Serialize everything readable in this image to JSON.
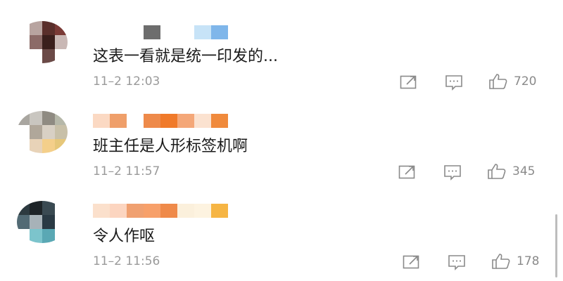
{
  "comments": [
    {
      "content": "这表一看就是统一印发的...",
      "time": "11–2 12:03",
      "likes": "720",
      "avatar_colors": [
        "#ffffff",
        "#b8a4a0",
        "#5a2f2b",
        "#7a3a36",
        "#ffffff",
        "#8c6b68",
        "#3a1f1c",
        "#c9b8b5",
        "#ffffff",
        "#ffffff",
        "#6b4a47",
        "#ffffff"
      ],
      "name_colors": [
        "#ffffff",
        "#ffffff",
        "#ffffff",
        "#6d6d6d",
        "#ffffff",
        "#ffffff",
        "#c7e3f7",
        "#7fb6ea"
      ]
    },
    {
      "content": "班主任是人形标签机啊",
      "time": "11–2 11:57",
      "likes": "345",
      "avatar_colors": [
        "#a9a6a0",
        "#c9c6c0",
        "#8f8b82",
        "#b6b8a9",
        "#ffffff",
        "#b0a79a",
        "#d8d0c4",
        "#c8c0a8",
        "#ffffff",
        "#e8d3b8",
        "#f4cf8a",
        "#e6c77a"
      ],
      "name_colors": [
        "#fbd9c3",
        "#ef9f6a",
        "#ffffff",
        "#ee8a4a",
        "#f07a2a",
        "#f4a778",
        "#fbe2d0",
        "#f08a3c"
      ]
    },
    {
      "content": "令人作呕",
      "time": "11–2 11:56",
      "likes": "178",
      "avatar_colors": [
        "#2d3a40",
        "#1e2428",
        "#3a4a52",
        "#ffffff",
        "#526a74",
        "#a7b2b8",
        "#2a3a44",
        "#ffffff",
        "#ffffff",
        "#7cc4cc",
        "#5aa8b4",
        "#ffffff"
      ],
      "name_colors": [
        "#fbe0cc",
        "#fcd5c0",
        "#f0a070",
        "#f7a06a",
        "#ef8a4a",
        "#fbf0dc",
        "#fdf3e0",
        "#f6b544"
      ]
    }
  ],
  "icons": {
    "share": "share-icon",
    "reply": "comment-reply-icon",
    "like": "thumbs-up-icon"
  }
}
